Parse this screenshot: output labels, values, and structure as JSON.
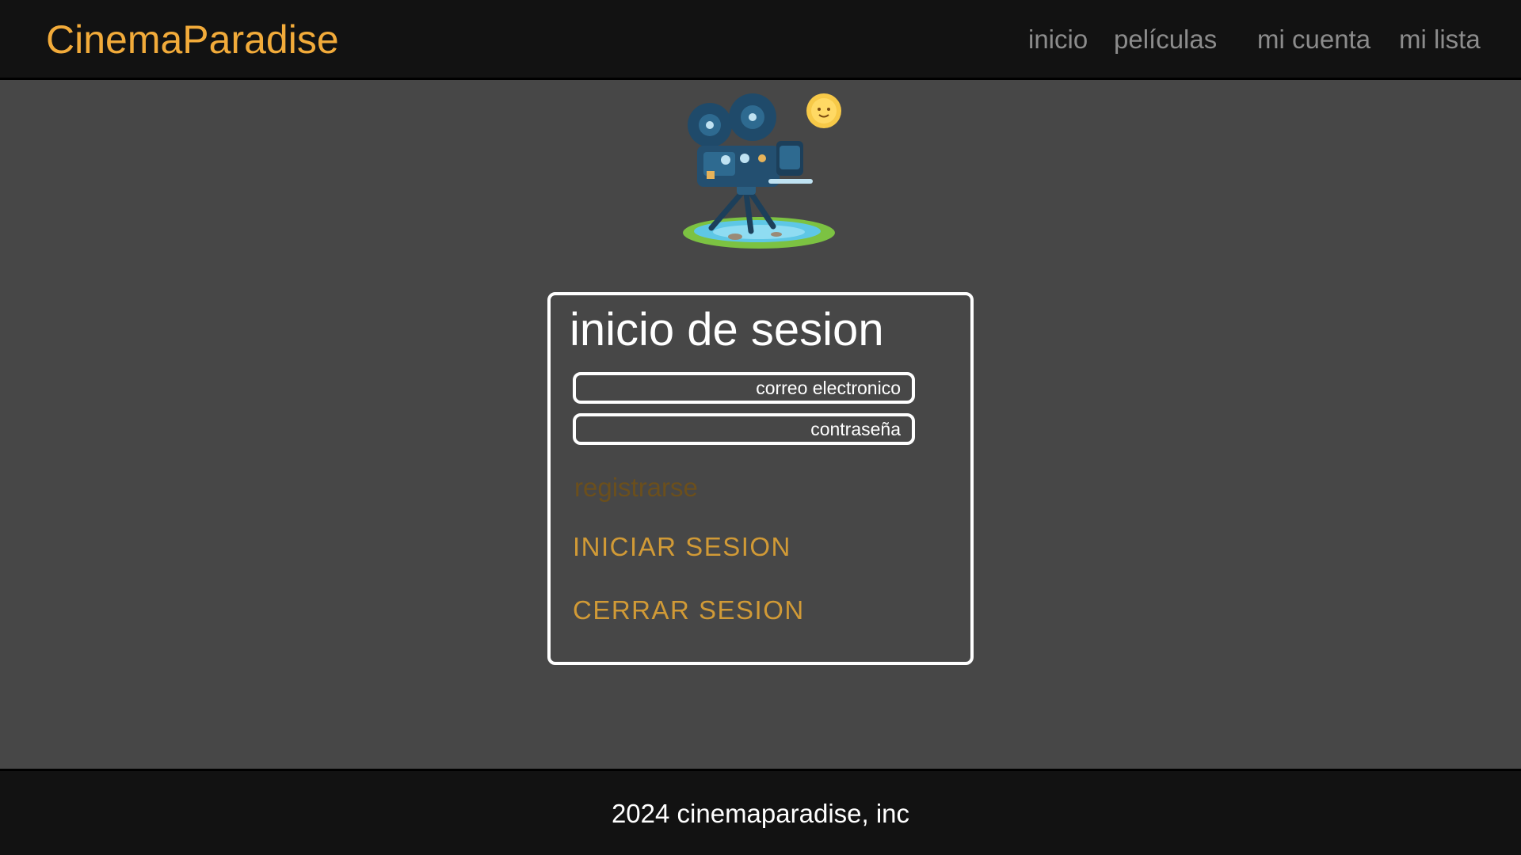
{
  "header": {
    "brand": "CinemaParadise",
    "nav": [
      "inicio",
      "películas",
      "mi cuenta",
      "mi lista"
    ]
  },
  "logo": {
    "icon": "film-camera-icon"
  },
  "login": {
    "title": "inicio de sesion",
    "email_placeholder": "correo electronico",
    "password_placeholder": "contraseña",
    "register_label": "registrarse",
    "login_button": "INICIAR SESION",
    "logout_button": "CERRAR SESION"
  },
  "footer": {
    "text": "2024 cinemaparadise, inc"
  },
  "colors": {
    "background": "#474747",
    "bar": "#121212",
    "brand": "#f2ab3a",
    "action": "#d19a36",
    "nav": "#8c8c8c"
  }
}
